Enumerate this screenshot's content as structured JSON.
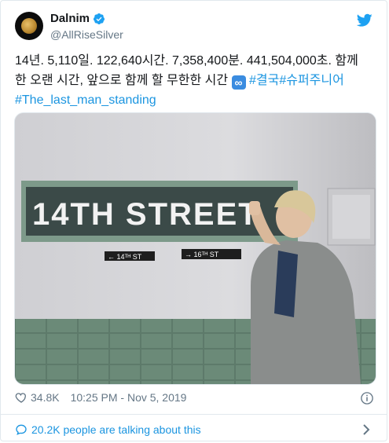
{
  "author": {
    "display_name": "Dalnim",
    "handle": "@AllRiseSilver",
    "verified": true
  },
  "tweet": {
    "line1": "14년. 5,110일. 122,640시간. 7,358,400분. 441,504,000초. 함께",
    "line2_text": "한 오랜 시간, 앞으로 함께 할 무한한 시간",
    "line2_emoji": "∞",
    "hashtag1": "#결국",
    "hashtag2": "#슈퍼주니어",
    "hashtag3": "#The_last_man_standing"
  },
  "photo": {
    "sign_main": "14TH STREET",
    "sign_left_arrow": "← 14ᵀᴴ ST",
    "sign_right_arrow": "→ 16ᵀᴴ ST"
  },
  "meta": {
    "likes": "34.8K",
    "timestamp": "10:25 PM - Nov 5, 2019"
  },
  "footer": {
    "talking_label": "20.2K people are talking about this"
  },
  "colors": {
    "link_blue": "#1b95e0",
    "twitter_blue": "#1da1f2",
    "secondary_text": "#657786"
  },
  "icons": [
    "verified-badge-icon",
    "twitter-bird-icon",
    "heart-icon",
    "info-icon",
    "speech-bubble-icon",
    "chevron-right-icon"
  ]
}
